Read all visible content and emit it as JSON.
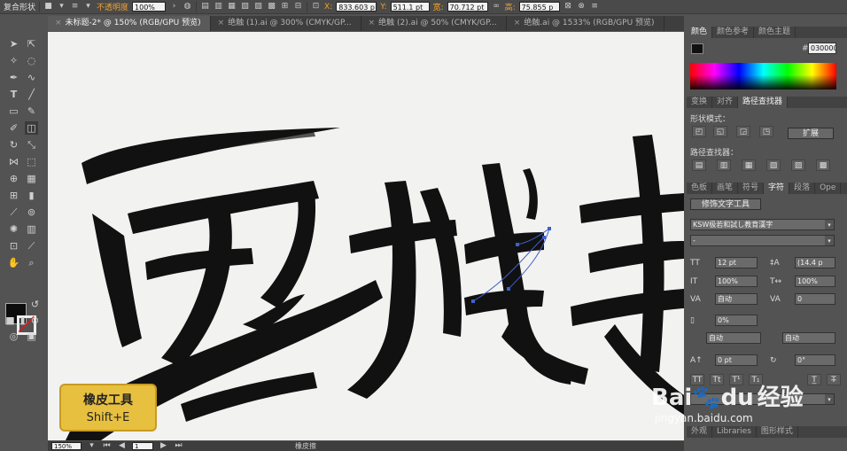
{
  "control_bar": {
    "mode_label": "复合形状",
    "opacity_label": "不透明度",
    "opacity_value": "100%",
    "x_label": "X:",
    "x_value": "833.603 p",
    "y_label": "Y:",
    "y_value": "511.1 pt",
    "w_label": "宽:",
    "w_value": "70.712 pt",
    "h_label": "高:",
    "h_value": "75.855 p"
  },
  "tabs": [
    {
      "label": "未标题-2* @ 150% (RGB/GPU 预览)",
      "active": true
    },
    {
      "label": "绝触 (1).ai @ 300% (CMYK/GP...",
      "active": false
    },
    {
      "label": "绝触 (2).ai @ 50% (CMYK/GP...",
      "active": false
    },
    {
      "label": "绝触.ai @ 1533% (RGB/GPU 预览)",
      "active": false
    }
  ],
  "tab_close": "×",
  "status": {
    "zoom": "150%",
    "page": "1",
    "tool_name": "橡皮擦"
  },
  "badge": {
    "title": "橡皮工具",
    "shortcut": "Shift+E"
  },
  "color_panel": {
    "tabs": [
      "颜色",
      "颜色参考",
      "颜色主题"
    ],
    "hex_label": "#",
    "hex_value": "030000"
  },
  "pathfinder_panel": {
    "tabs": [
      "变换",
      "对齐",
      "路径查找器"
    ],
    "shape_modes_label": "形状模式：",
    "pathfinders_label": "路径查找器：",
    "expand_button": "扩展"
  },
  "char_panel": {
    "tabs": [
      "色板",
      "画笔",
      "符号",
      "字符",
      "段落",
      "Ope"
    ],
    "touch_type_button": "修饰文字工具",
    "font_family": "KSW极若和試し教育漢字",
    "font_style": "-",
    "size": "12 pt",
    "leading": "(14.4 p",
    "vscale": "100%",
    "hscale": "100%",
    "kerning": "自动",
    "tracking": "0",
    "tsume": "0%",
    "aki_left": "自动",
    "aki_right": "自动",
    "baseline": "0 pt",
    "rotation": "0°"
  },
  "bottom_tabs": [
    "外观",
    "Libraries",
    "图形样式"
  ],
  "watermark": {
    "brand": "Bai",
    "paw": "du",
    "site_cn": "经验",
    "site_url": "jingyan.baidu.com"
  },
  "colors": {
    "app_bg": "#535353",
    "canvas_bg": "#f2f2f0",
    "ink": "#111111",
    "badge": "#e8c040",
    "accent": "#f0a030"
  }
}
